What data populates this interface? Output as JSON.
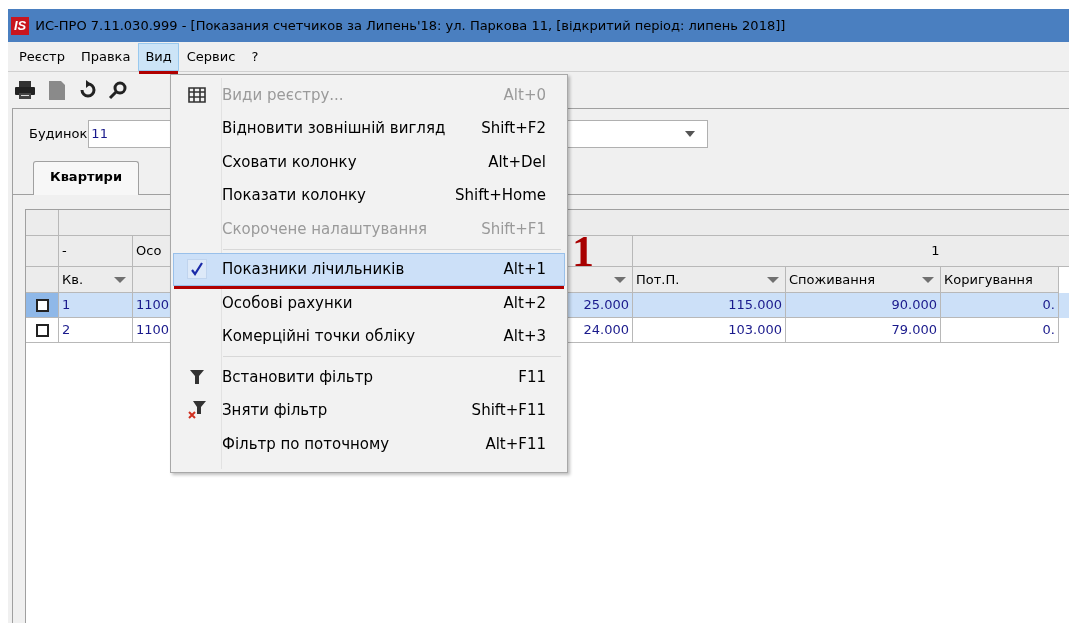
{
  "window": {
    "logo": "IS",
    "title": "ИС-ПРО 7.11.030.999 - [Показания счетчиков за  Липень'18: ул. Паркова 11, [відкритий період: липень 2018]]"
  },
  "menu_bar": [
    {
      "label": "Реєстр",
      "selected": false
    },
    {
      "label": "Правка",
      "selected": false
    },
    {
      "label": "Вид",
      "selected": true
    },
    {
      "label": "Сервис",
      "selected": false
    },
    {
      "label": "?",
      "selected": false
    }
  ],
  "filter": {
    "label": "Будинок",
    "value": "11"
  },
  "tabs": [
    {
      "label": "Квартири",
      "selected": true
    }
  ],
  "grid": {
    "group_label": "1",
    "columns": [
      {
        "top": "-",
        "header": "Кв.",
        "sort": true
      },
      {
        "top": "Осо",
        "sort": false
      },
      {
        "sort": true
      },
      {
        "header": "Пот.П.",
        "sort": true
      },
      {
        "header": "Споживання",
        "sort": true
      },
      {
        "header": "Коригування",
        "sort": false
      }
    ],
    "rows": [
      {
        "checked": false,
        "selected": true,
        "cells": [
          "1",
          "1100",
          "25.000",
          "115.000",
          "90.000",
          "0."
        ]
      },
      {
        "checked": false,
        "selected": false,
        "cells": [
          "2",
          "1100",
          "24.000",
          "103.000",
          "79.000",
          "0."
        ]
      }
    ]
  },
  "dropdown_menu": [
    {
      "kind": "item",
      "label": "Види реєстру...",
      "shortcut": "Alt+0",
      "disabled": true,
      "checked": false,
      "selected": false
    },
    {
      "kind": "item",
      "label": "Відновити зовнішній вигляд",
      "shortcut": "Shift+F2",
      "disabled": false,
      "checked": false,
      "selected": false
    },
    {
      "kind": "item",
      "label": "Сховати колонку",
      "shortcut": "Alt+Del",
      "disabled": false,
      "checked": false,
      "selected": false
    },
    {
      "kind": "item",
      "label": "Показати колонку",
      "shortcut": "Shift+Home",
      "disabled": false,
      "checked": false,
      "selected": false
    },
    {
      "kind": "item",
      "label": "Скорочене налаштування",
      "shortcut": "Shift+F1",
      "disabled": true,
      "checked": false,
      "selected": false
    },
    {
      "kind": "separator"
    },
    {
      "kind": "item",
      "label": "Показники лічильників",
      "shortcut": "Alt+1",
      "disabled": false,
      "checked": true,
      "selected": true
    },
    {
      "kind": "item",
      "label": "Особові рахунки",
      "shortcut": "Alt+2",
      "disabled": false,
      "checked": false,
      "selected": false
    },
    {
      "kind": "item",
      "label": "Комерційні точки обліку",
      "shortcut": "Alt+3",
      "disabled": false,
      "checked": false,
      "selected": false
    },
    {
      "kind": "separator"
    },
    {
      "kind": "item",
      "label": "Встановити фільтр",
      "shortcut": "F11",
      "disabled": false,
      "checked": false,
      "selected": false
    },
    {
      "kind": "item",
      "label": "Зняти фільтр",
      "shortcut": "Shift+F11",
      "disabled": false,
      "checked": false,
      "selected": false
    },
    {
      "kind": "item",
      "label": "Фільтр по поточному",
      "shortcut": "Alt+F11",
      "disabled": false,
      "checked": false,
      "selected": false
    }
  ],
  "annotation": {
    "label": "1"
  }
}
